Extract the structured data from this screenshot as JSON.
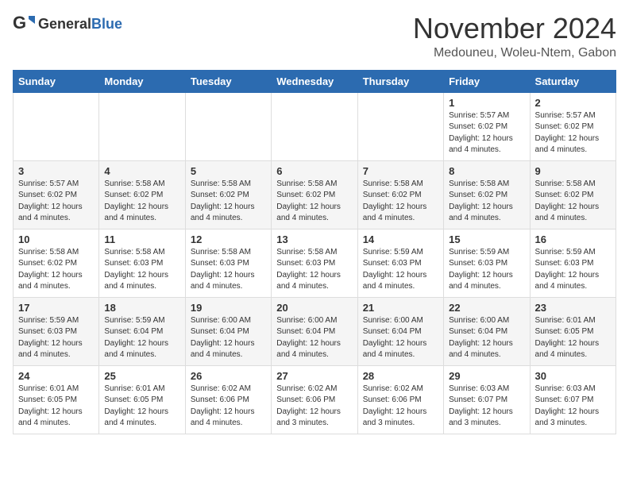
{
  "logo": {
    "general": "General",
    "blue": "Blue"
  },
  "header": {
    "month": "November 2024",
    "location": "Medouneu, Woleu-Ntem, Gabon"
  },
  "weekdays": [
    "Sunday",
    "Monday",
    "Tuesday",
    "Wednesday",
    "Thursday",
    "Friday",
    "Saturday"
  ],
  "weeks": [
    [
      {
        "day": "",
        "info": ""
      },
      {
        "day": "",
        "info": ""
      },
      {
        "day": "",
        "info": ""
      },
      {
        "day": "",
        "info": ""
      },
      {
        "day": "",
        "info": ""
      },
      {
        "day": "1",
        "info": "Sunrise: 5:57 AM\nSunset: 6:02 PM\nDaylight: 12 hours and 4 minutes."
      },
      {
        "day": "2",
        "info": "Sunrise: 5:57 AM\nSunset: 6:02 PM\nDaylight: 12 hours and 4 minutes."
      }
    ],
    [
      {
        "day": "3",
        "info": "Sunrise: 5:57 AM\nSunset: 6:02 PM\nDaylight: 12 hours and 4 minutes."
      },
      {
        "day": "4",
        "info": "Sunrise: 5:58 AM\nSunset: 6:02 PM\nDaylight: 12 hours and 4 minutes."
      },
      {
        "day": "5",
        "info": "Sunrise: 5:58 AM\nSunset: 6:02 PM\nDaylight: 12 hours and 4 minutes."
      },
      {
        "day": "6",
        "info": "Sunrise: 5:58 AM\nSunset: 6:02 PM\nDaylight: 12 hours and 4 minutes."
      },
      {
        "day": "7",
        "info": "Sunrise: 5:58 AM\nSunset: 6:02 PM\nDaylight: 12 hours and 4 minutes."
      },
      {
        "day": "8",
        "info": "Sunrise: 5:58 AM\nSunset: 6:02 PM\nDaylight: 12 hours and 4 minutes."
      },
      {
        "day": "9",
        "info": "Sunrise: 5:58 AM\nSunset: 6:02 PM\nDaylight: 12 hours and 4 minutes."
      }
    ],
    [
      {
        "day": "10",
        "info": "Sunrise: 5:58 AM\nSunset: 6:02 PM\nDaylight: 12 hours and 4 minutes."
      },
      {
        "day": "11",
        "info": "Sunrise: 5:58 AM\nSunset: 6:03 PM\nDaylight: 12 hours and 4 minutes."
      },
      {
        "day": "12",
        "info": "Sunrise: 5:58 AM\nSunset: 6:03 PM\nDaylight: 12 hours and 4 minutes."
      },
      {
        "day": "13",
        "info": "Sunrise: 5:58 AM\nSunset: 6:03 PM\nDaylight: 12 hours and 4 minutes."
      },
      {
        "day": "14",
        "info": "Sunrise: 5:59 AM\nSunset: 6:03 PM\nDaylight: 12 hours and 4 minutes."
      },
      {
        "day": "15",
        "info": "Sunrise: 5:59 AM\nSunset: 6:03 PM\nDaylight: 12 hours and 4 minutes."
      },
      {
        "day": "16",
        "info": "Sunrise: 5:59 AM\nSunset: 6:03 PM\nDaylight: 12 hours and 4 minutes."
      }
    ],
    [
      {
        "day": "17",
        "info": "Sunrise: 5:59 AM\nSunset: 6:03 PM\nDaylight: 12 hours and 4 minutes."
      },
      {
        "day": "18",
        "info": "Sunrise: 5:59 AM\nSunset: 6:04 PM\nDaylight: 12 hours and 4 minutes."
      },
      {
        "day": "19",
        "info": "Sunrise: 6:00 AM\nSunset: 6:04 PM\nDaylight: 12 hours and 4 minutes."
      },
      {
        "day": "20",
        "info": "Sunrise: 6:00 AM\nSunset: 6:04 PM\nDaylight: 12 hours and 4 minutes."
      },
      {
        "day": "21",
        "info": "Sunrise: 6:00 AM\nSunset: 6:04 PM\nDaylight: 12 hours and 4 minutes."
      },
      {
        "day": "22",
        "info": "Sunrise: 6:00 AM\nSunset: 6:04 PM\nDaylight: 12 hours and 4 minutes."
      },
      {
        "day": "23",
        "info": "Sunrise: 6:01 AM\nSunset: 6:05 PM\nDaylight: 12 hours and 4 minutes."
      }
    ],
    [
      {
        "day": "24",
        "info": "Sunrise: 6:01 AM\nSunset: 6:05 PM\nDaylight: 12 hours and 4 minutes."
      },
      {
        "day": "25",
        "info": "Sunrise: 6:01 AM\nSunset: 6:05 PM\nDaylight: 12 hours and 4 minutes."
      },
      {
        "day": "26",
        "info": "Sunrise: 6:02 AM\nSunset: 6:06 PM\nDaylight: 12 hours and 4 minutes."
      },
      {
        "day": "27",
        "info": "Sunrise: 6:02 AM\nSunset: 6:06 PM\nDaylight: 12 hours and 3 minutes."
      },
      {
        "day": "28",
        "info": "Sunrise: 6:02 AM\nSunset: 6:06 PM\nDaylight: 12 hours and 3 minutes."
      },
      {
        "day": "29",
        "info": "Sunrise: 6:03 AM\nSunset: 6:07 PM\nDaylight: 12 hours and 3 minutes."
      },
      {
        "day": "30",
        "info": "Sunrise: 6:03 AM\nSunset: 6:07 PM\nDaylight: 12 hours and 3 minutes."
      }
    ]
  ]
}
